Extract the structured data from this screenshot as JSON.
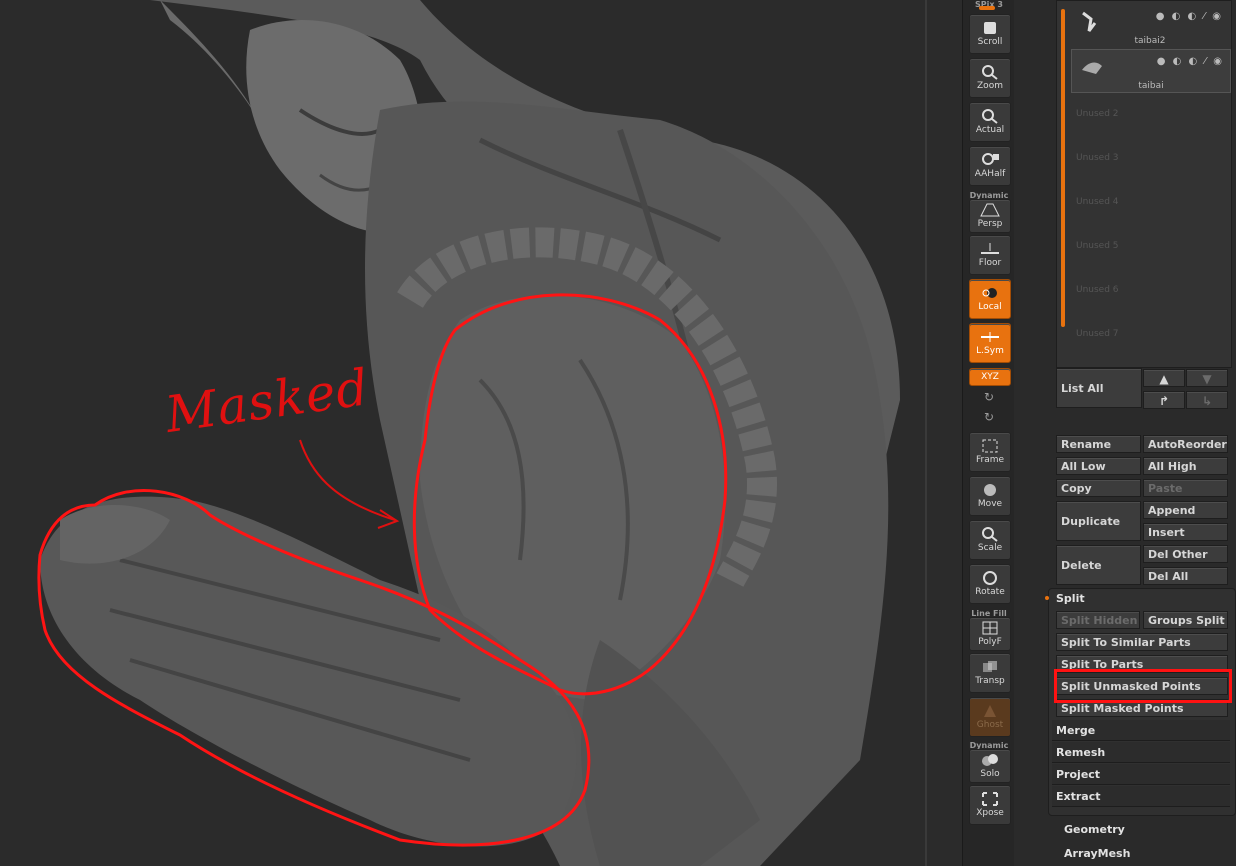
{
  "annotation": {
    "mask_label": "Masked",
    "color": "#e01010"
  },
  "shelf": {
    "top_label": "SPix 3",
    "buttons": [
      {
        "id": "scroll",
        "label": "Scroll",
        "sub": ""
      },
      {
        "id": "zoom",
        "label": "Zoom",
        "sub": ""
      },
      {
        "id": "actual",
        "label": "Actual",
        "sub": ""
      },
      {
        "id": "aahalf",
        "label": "AAHalf",
        "sub": ""
      },
      {
        "id": "persp",
        "label": "Persp",
        "sub": "Dynamic"
      },
      {
        "id": "floor",
        "label": "Floor",
        "sub": ""
      },
      {
        "id": "local",
        "label": "Local",
        "sub": ""
      },
      {
        "id": "lsym",
        "label": "L.Sym",
        "sub": ""
      },
      {
        "id": "xyz",
        "label": "XYZ",
        "sub": ""
      },
      {
        "id": "frame",
        "label": "Frame",
        "sub": ""
      },
      {
        "id": "move",
        "label": "Move",
        "sub": ""
      },
      {
        "id": "scale",
        "label": "Scale",
        "sub": ""
      },
      {
        "id": "rotate",
        "label": "Rotate",
        "sub": ""
      },
      {
        "id": "polyf",
        "label": "PolyF",
        "sub": "Line Fill"
      },
      {
        "id": "transp",
        "label": "Transp",
        "sub": ""
      },
      {
        "id": "ghost",
        "label": "Ghost",
        "sub": ""
      },
      {
        "id": "solo",
        "label": "Solo",
        "sub": "Dynamic"
      },
      {
        "id": "xpose",
        "label": "Xpose",
        "sub": ""
      }
    ],
    "accent": "#e8720f"
  },
  "subtool": {
    "items": [
      {
        "name": "taibai2"
      },
      {
        "name": "taibai"
      }
    ],
    "unused": [
      "Unused 2",
      "Unused 3",
      "Unused 4",
      "Unused 5",
      "Unused 6",
      "Unused 7"
    ],
    "list_all": "List All",
    "buttons": {
      "rename": "Rename",
      "autoreorder": "AutoReorder",
      "all_low": "All Low",
      "all_high": "All High",
      "copy": "Copy",
      "paste": "Paste",
      "duplicate": "Duplicate",
      "append": "Append",
      "insert": "Insert",
      "delete": "Delete",
      "del_other": "Del Other",
      "del_all": "Del All"
    }
  },
  "split": {
    "title": "Split",
    "split_hidden": "Split Hidden",
    "groups_split": "Groups Split",
    "similar": "Split To Similar Parts",
    "parts": "Split To Parts",
    "unmasked": "Split Unmasked Points",
    "masked": "Split Masked Points"
  },
  "sections": [
    "Merge",
    "Remesh",
    "Project",
    "Extract"
  ],
  "bottom_sections": [
    "Geometry",
    "ArrayMesh"
  ]
}
